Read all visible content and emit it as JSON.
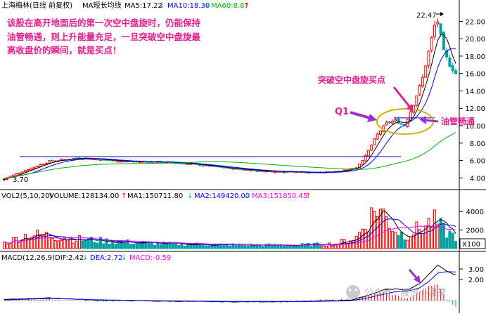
{
  "main_header": {
    "title": "上海梅林(日线 前复权)",
    "study": "MA短长均线",
    "ma5": "MA5:17.22",
    "ma10": "MA10:18.30",
    "ma60": "MA60:8.87"
  },
  "vol_header": {
    "title": "VOL2(5,10,20)",
    "volume": "VOLUME:128134.00",
    "ma1": "MA1:150711.80",
    "ma2": "MA2:149420.00",
    "ma3": "MA3:151850.45"
  },
  "macd_header": {
    "title": "MACD(12,26,9)",
    "dif": "DIF:2.42",
    "dea": "DEA:2.72",
    "macd": "MACD:-0.59"
  },
  "annotations": {
    "note": [
      "该股在高开地面后的第一次空中盘旋时，仍能保持",
      "油管畅通，则上升能量充足，一旦突破空中盘旋最",
      "高收盘价的瞬间，就是买点！"
    ],
    "breakout": "突破空中盘旋买点",
    "q1": "Q1",
    "pipeline": "油管畅通",
    "high_label": "22.47",
    "low_label": "3.70",
    "x100": "X100"
  },
  "watermark": "公众号 · 股市小课堂",
  "colors": {
    "up": "#ff0000",
    "down": "#00a0a0",
    "ma5": "#000000",
    "ma10": "#0000ff",
    "ma60": "#00b000",
    "annotation": "#e0208c",
    "dif": "#000000",
    "dea": "#0000ff",
    "vma3": "#ff00ff"
  },
  "chart_data": [
    {
      "type": "candlestick",
      "title": "上海梅林(日线 前复权)",
      "y_ticks": [
        4.0,
        6.0,
        8.0,
        10.0,
        12.0,
        14.0,
        16.0,
        18.0,
        20.0,
        22.0
      ],
      "ylim": [
        3.3,
        23.0
      ],
      "labeled_high": 22.47,
      "labeled_low": 3.7,
      "horizontal_lines": [
        6.45,
        10.9
      ],
      "close_profile": [
        [
          0,
          3.9
        ],
        [
          8,
          5.0
        ],
        [
          15,
          5.9
        ],
        [
          25,
          6.3
        ],
        [
          40,
          5.9
        ],
        [
          55,
          5.8
        ],
        [
          65,
          5.5
        ],
        [
          75,
          5.1
        ],
        [
          85,
          4.8
        ],
        [
          95,
          4.7
        ],
        [
          105,
          4.6
        ],
        [
          112,
          4.8
        ],
        [
          117,
          5.2
        ],
        [
          120,
          6.5
        ],
        [
          124,
          9.0
        ],
        [
          127,
          10.3
        ],
        [
          130,
          10.6
        ],
        [
          133,
          10.0
        ],
        [
          136,
          12.5
        ],
        [
          139,
          15.5
        ],
        [
          141,
          18.5
        ],
        [
          143,
          21.5
        ],
        [
          144,
          22.0
        ],
        [
          146,
          18.5
        ],
        [
          148,
          17.0
        ],
        [
          150,
          16.0
        ]
      ],
      "ma_series": [
        {
          "name": "MA5",
          "value": 17.22
        },
        {
          "name": "MA10",
          "value": 18.3
        },
        {
          "name": "MA60",
          "value": 8.87
        }
      ]
    },
    {
      "type": "bar",
      "title": "VOL2(5,10,20)",
      "y_ticks": [
        2000,
        4000
      ],
      "ylim": [
        0,
        5000
      ],
      "unit_multiplier": 100,
      "volume_profile": [
        [
          0,
          600
        ],
        [
          8,
          1500
        ],
        [
          15,
          1400
        ],
        [
          25,
          1000
        ],
        [
          40,
          700
        ],
        [
          55,
          500
        ],
        [
          75,
          400
        ],
        [
          95,
          350
        ],
        [
          110,
          500
        ],
        [
          117,
          1200
        ],
        [
          120,
          2600
        ],
        [
          124,
          4500
        ],
        [
          127,
          3300
        ],
        [
          130,
          2000
        ],
        [
          133,
          1400
        ],
        [
          136,
          1900
        ],
        [
          139,
          2300
        ],
        [
          141,
          2700
        ],
        [
          143,
          2900
        ],
        [
          144,
          2700
        ],
        [
          146,
          1900
        ],
        [
          148,
          1600
        ],
        [
          150,
          1300
        ]
      ],
      "series": [
        {
          "name": "VOLUME",
          "value": 128134.0
        },
        {
          "name": "MA1",
          "value": 150711.8
        },
        {
          "name": "MA2",
          "value": 149420.0
        },
        {
          "name": "MA3",
          "value": 151850.45
        }
      ]
    },
    {
      "type": "line",
      "title": "MACD(12,26,9)",
      "y_ticks": [
        2.0,
        3.0
      ],
      "ylim": [
        -0.8,
        3.6
      ],
      "dif_profile": [
        [
          0,
          0.1
        ],
        [
          15,
          0.25
        ],
        [
          30,
          0.05
        ],
        [
          50,
          -0.05
        ],
        [
          75,
          -0.12
        ],
        [
          100,
          -0.1
        ],
        [
          115,
          0.05
        ],
        [
          120,
          0.4
        ],
        [
          126,
          1.0
        ],
        [
          130,
          1.1
        ],
        [
          134,
          1.0
        ],
        [
          138,
          1.6
        ],
        [
          141,
          2.5
        ],
        [
          144,
          3.35
        ],
        [
          147,
          2.8
        ],
        [
          150,
          2.42
        ]
      ],
      "dea_profile": [
        [
          0,
          0.05
        ],
        [
          15,
          0.2
        ],
        [
          30,
          0.08
        ],
        [
          50,
          -0.02
        ],
        [
          75,
          -0.1
        ],
        [
          100,
          -0.1
        ],
        [
          115,
          -0.02
        ],
        [
          120,
          0.2
        ],
        [
          126,
          0.6
        ],
        [
          130,
          0.85
        ],
        [
          134,
          0.9
        ],
        [
          138,
          1.2
        ],
        [
          141,
          1.8
        ],
        [
          144,
          2.6
        ],
        [
          147,
          2.75
        ],
        [
          150,
          2.72
        ]
      ],
      "series": [
        {
          "name": "DIF",
          "value": 2.42
        },
        {
          "name": "DEA",
          "value": 2.72
        },
        {
          "name": "MACD",
          "value": -0.59
        }
      ]
    }
  ]
}
